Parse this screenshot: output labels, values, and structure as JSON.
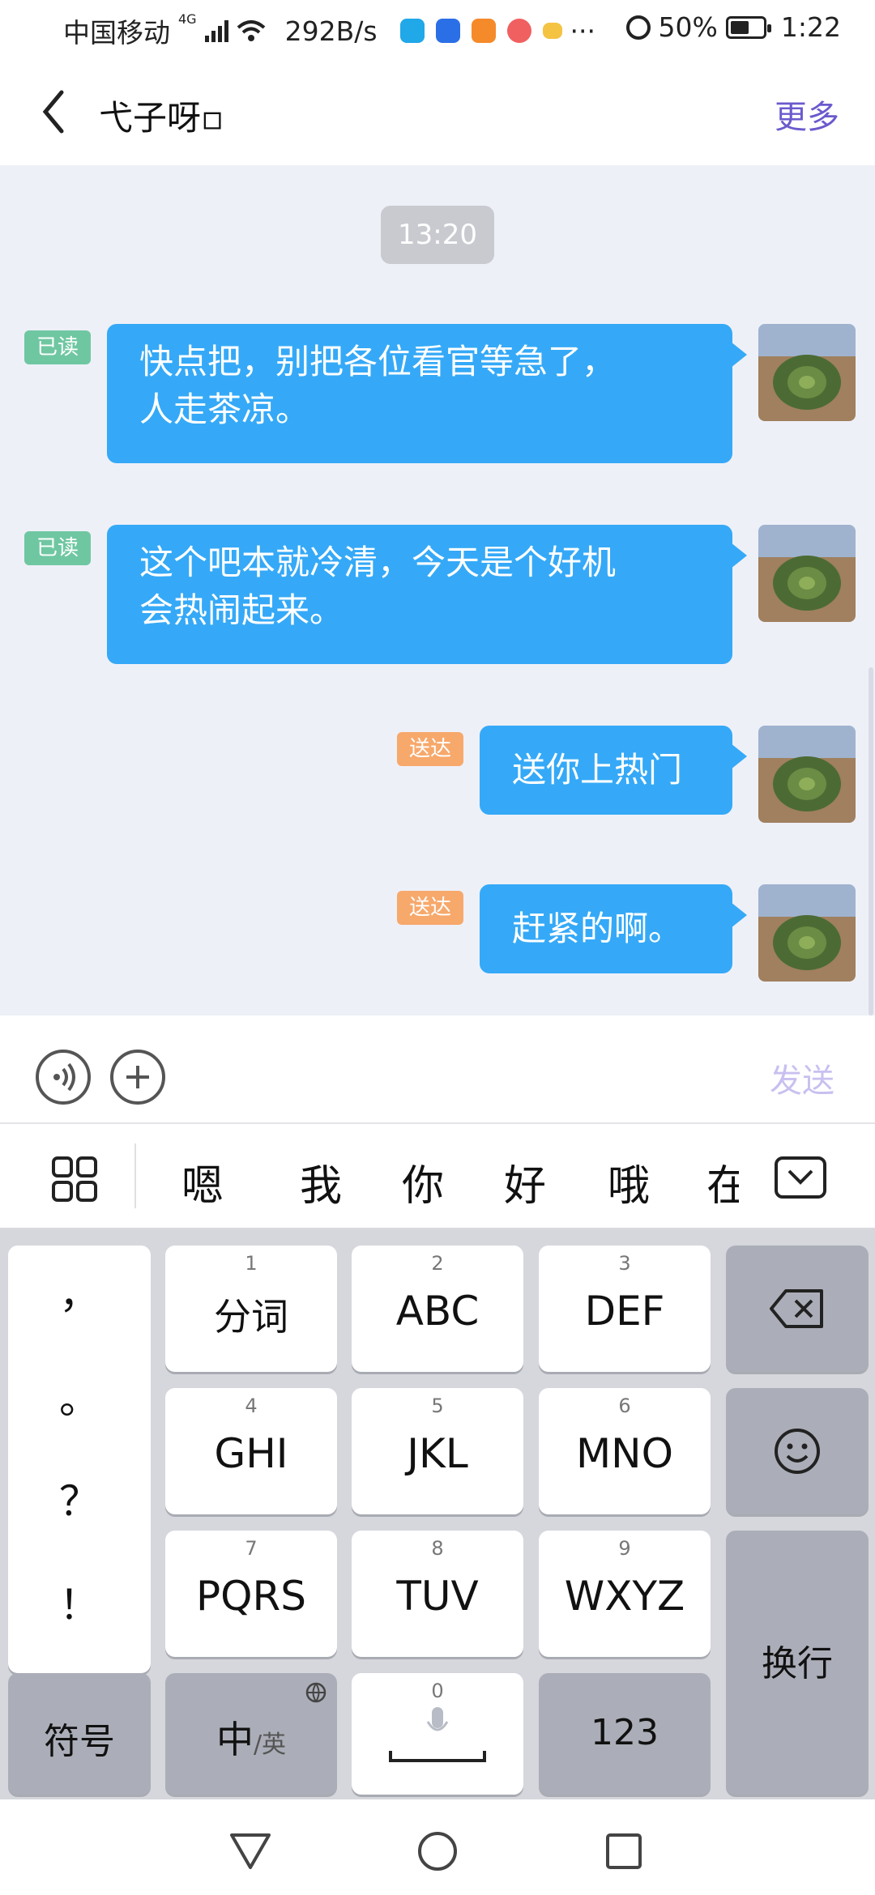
{
  "status_bar": {
    "carrier": "中国移动",
    "network": "4G",
    "speed": "292B/s",
    "more": "···",
    "battery": "50%",
    "time": "1:22"
  },
  "header": {
    "title": "弋子呀▫",
    "more_label": "更多"
  },
  "chat": {
    "time_badge": "13:20",
    "messages": [
      {
        "status": "已读",
        "text_line1": "快点把，别把各位看官等急了，",
        "text_line2": "人走茶凉。"
      },
      {
        "status": "已读",
        "text_line1": "这个吧本就冷清，今天是个好机",
        "text_line2": "会热闹起来。"
      },
      {
        "status": "送达",
        "text": "送你上热门"
      },
      {
        "status": "送达",
        "text": "赶紧的啊。"
      }
    ]
  },
  "input_bar": {
    "send_label": "发送"
  },
  "candidates": [
    "嗯",
    "我",
    "你",
    "好",
    "哦",
    "在"
  ],
  "keyboard": {
    "punct": [
      "，",
      "。",
      "？",
      "！"
    ],
    "keys": [
      {
        "num": "1",
        "label": "分词"
      },
      {
        "num": "2",
        "label": "ABC"
      },
      {
        "num": "3",
        "label": "DEF"
      },
      {
        "num": "4",
        "label": "GHI"
      },
      {
        "num": "5",
        "label": "JKL"
      },
      {
        "num": "6",
        "label": "MNO"
      },
      {
        "num": "7",
        "label": "PQRS"
      },
      {
        "num": "8",
        "label": "TUV"
      },
      {
        "num": "9",
        "label": "WXYZ"
      }
    ],
    "enter_label": "换行",
    "symbols_label": "符号",
    "lang_main": "中",
    "lang_alt": "/英",
    "space_num": "0",
    "num_label": "123"
  },
  "colors": {
    "bubble": "#35a9f7",
    "read_tag": "#6fc7a1",
    "sent_tag": "#f7a86b",
    "accent": "#6a5acd"
  }
}
